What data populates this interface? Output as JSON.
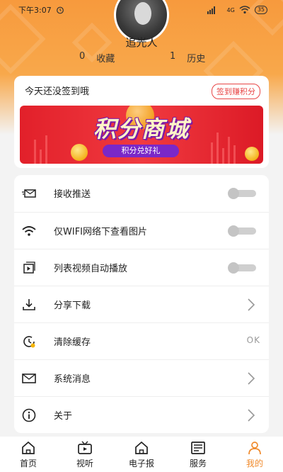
{
  "status_bar": {
    "time": "下午3:07",
    "battery": "35",
    "network": "4G"
  },
  "profile": {
    "username": "追光人",
    "favorites_count": "0",
    "favorites_label": "收藏",
    "history_count": "1",
    "history_label": "历史"
  },
  "signin": {
    "title": "今天还没签到哦",
    "button_label": "签到赚积分"
  },
  "banner": {
    "title": "积分商城",
    "subtitle": "积分兑好礼"
  },
  "settings": [
    {
      "key": "push",
      "label": "接收推送",
      "icon": "envelope-send-icon",
      "control": "toggle",
      "enabled": false
    },
    {
      "key": "wifi_images",
      "label": "仅WIFI网络下查看图片",
      "icon": "wifi-icon",
      "control": "toggle",
      "enabled": false
    },
    {
      "key": "autoplay",
      "label": "列表视频自动播放",
      "icon": "video-play-icon",
      "control": "toggle",
      "enabled": false
    },
    {
      "key": "share_download",
      "label": "分享下载",
      "icon": "download-icon",
      "control": "chevron"
    },
    {
      "key": "clear_cache",
      "label": "清除缓存",
      "icon": "clock-clear-icon",
      "control": "value",
      "value": "OK"
    },
    {
      "key": "messages",
      "label": "系统消息",
      "icon": "mail-icon",
      "control": "chevron"
    },
    {
      "key": "about",
      "label": "关于",
      "icon": "info-icon",
      "control": "chevron"
    }
  ],
  "tabs": [
    {
      "label": "首页",
      "icon": "home-icon",
      "active": false
    },
    {
      "label": "视听",
      "icon": "tv-icon",
      "active": false
    },
    {
      "label": "电子报",
      "icon": "home-outline-icon",
      "active": false
    },
    {
      "label": "服务",
      "icon": "newspaper-icon",
      "active": false
    },
    {
      "label": "我的",
      "icon": "person-icon",
      "active": true
    }
  ],
  "colors": {
    "accent": "#f08a2c",
    "header": "#f79a3d",
    "badge_red": "#e84545",
    "banner_red": "#e2202a",
    "banner_purple": "#7a28c8"
  }
}
